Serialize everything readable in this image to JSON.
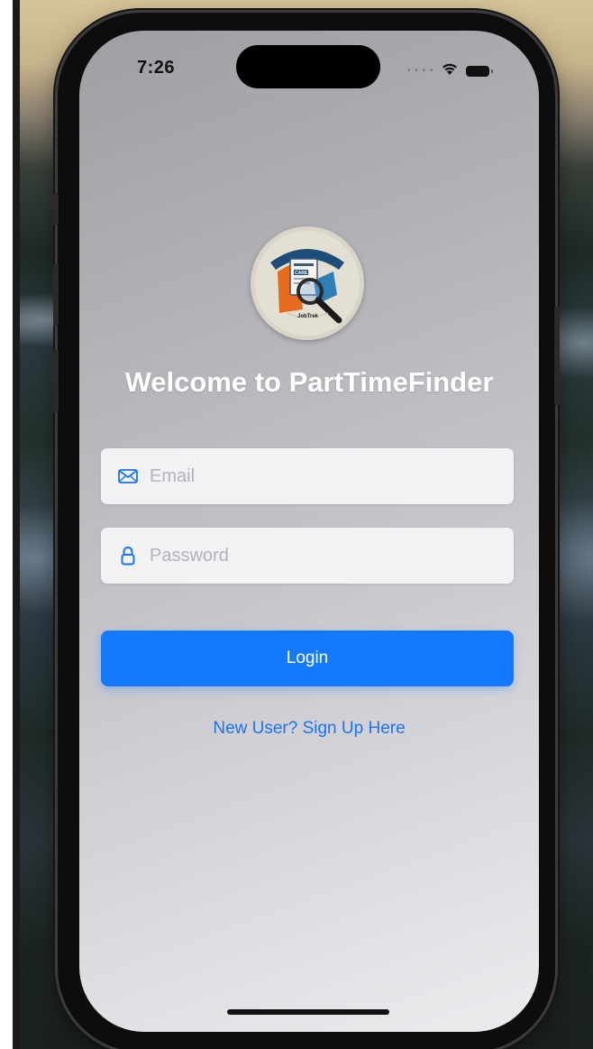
{
  "status_bar": {
    "time": "7:26",
    "signal_icon": "cellular-dots-icon",
    "wifi_icon": "wifi-icon",
    "battery_icon": "battery-icon"
  },
  "logo": {
    "icon": "jobtrek-logo-icon",
    "text": "JobTrek",
    "card_text": "CARE"
  },
  "title": "Welcome to PartTimeFinder",
  "email": {
    "icon": "envelope-icon",
    "placeholder": "Email",
    "value": ""
  },
  "password": {
    "icon": "lock-icon",
    "placeholder": "Password",
    "value": ""
  },
  "login_button": {
    "label": "Login"
  },
  "signup_link": {
    "label": "New User? Sign Up Here"
  },
  "colors": {
    "accent": "#1479ff",
    "link": "#1a74f0",
    "title": "#ffffff"
  }
}
